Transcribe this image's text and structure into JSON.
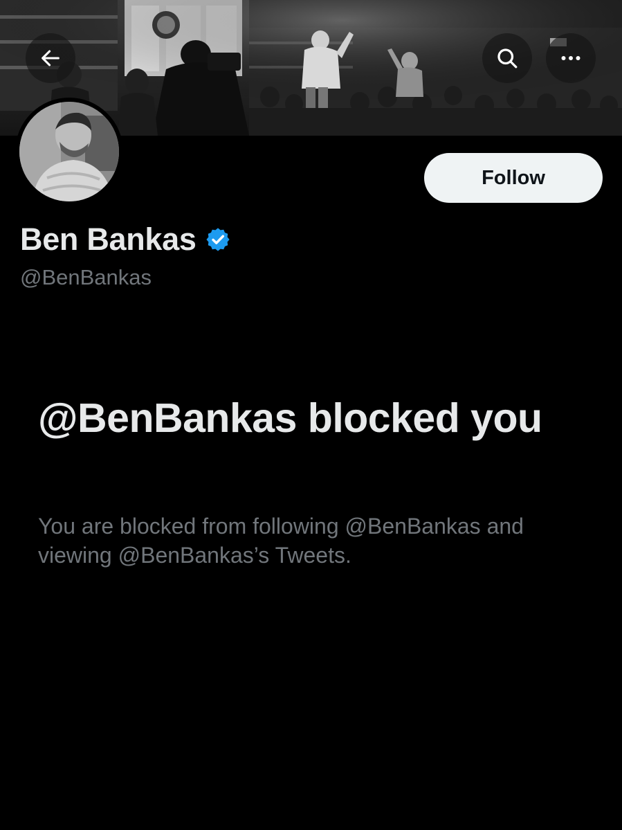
{
  "header": {
    "back_icon": "arrow-left-icon",
    "search_icon": "search-icon",
    "more_icon": "more-horizontal-icon"
  },
  "banner": {
    "description_tone": "grayscale"
  },
  "profile": {
    "display_name": "Ben Bankas",
    "handle": "@BenBankas",
    "verified": true,
    "verified_color": "#1d9bf0",
    "follow_label": "Follow"
  },
  "blocked": {
    "title": "@BenBankas blocked you",
    "description": "You are blocked from following @BenBankas and viewing @BenBankas’s Tweets."
  },
  "colors": {
    "background": "#000000",
    "primary_text": "#e7e9ea",
    "secondary_text": "#71767b",
    "follow_bg": "#eff3f4",
    "follow_text": "#0f1419"
  }
}
